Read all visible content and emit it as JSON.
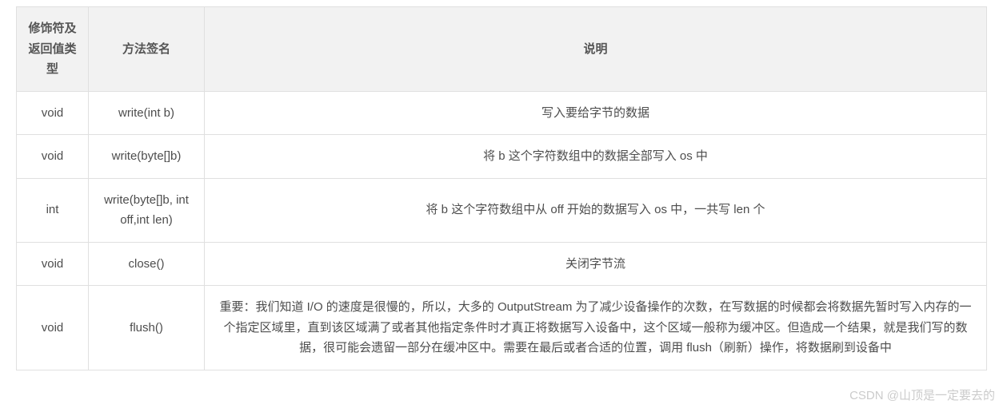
{
  "table": {
    "headers": {
      "col1": "修饰符及返回值类型",
      "col2": "方法签名",
      "col3": "说明"
    },
    "rows": [
      {
        "returnType": "void",
        "signature": "write(int b)",
        "description": "写入要给字节的数据"
      },
      {
        "returnType": "void",
        "signature": "write(byte[]b)",
        "description": "将 b 这个字符数组中的数据全部写入 os 中"
      },
      {
        "returnType": "int",
        "signature": "write(byte[]b, int off,int len)",
        "description": "将 b 这个字符数组中从 off 开始的数据写入 os 中，一共写 len 个"
      },
      {
        "returnType": "void",
        "signature": "close()",
        "description": "关闭字节流"
      },
      {
        "returnType": "void",
        "signature": "flush()",
        "description": "重要：我们知道 I/O 的速度是很慢的，所以，大多的 OutputStream 为了减少设备操作的次数，在写数据的时候都会将数据先暂时写入内存的一个指定区域里，直到该区域满了或者其他指定条件时才真正将数据写入设备中，这个区域一般称为缓冲区。但造成一个结果，就是我们写的数据，很可能会遗留一部分在缓冲区中。需要在最后或者合适的位置，调用 flush（刷新）操作，将数据刷到设备中"
      }
    ]
  },
  "watermark": "CSDN @山顶是一定要去的"
}
